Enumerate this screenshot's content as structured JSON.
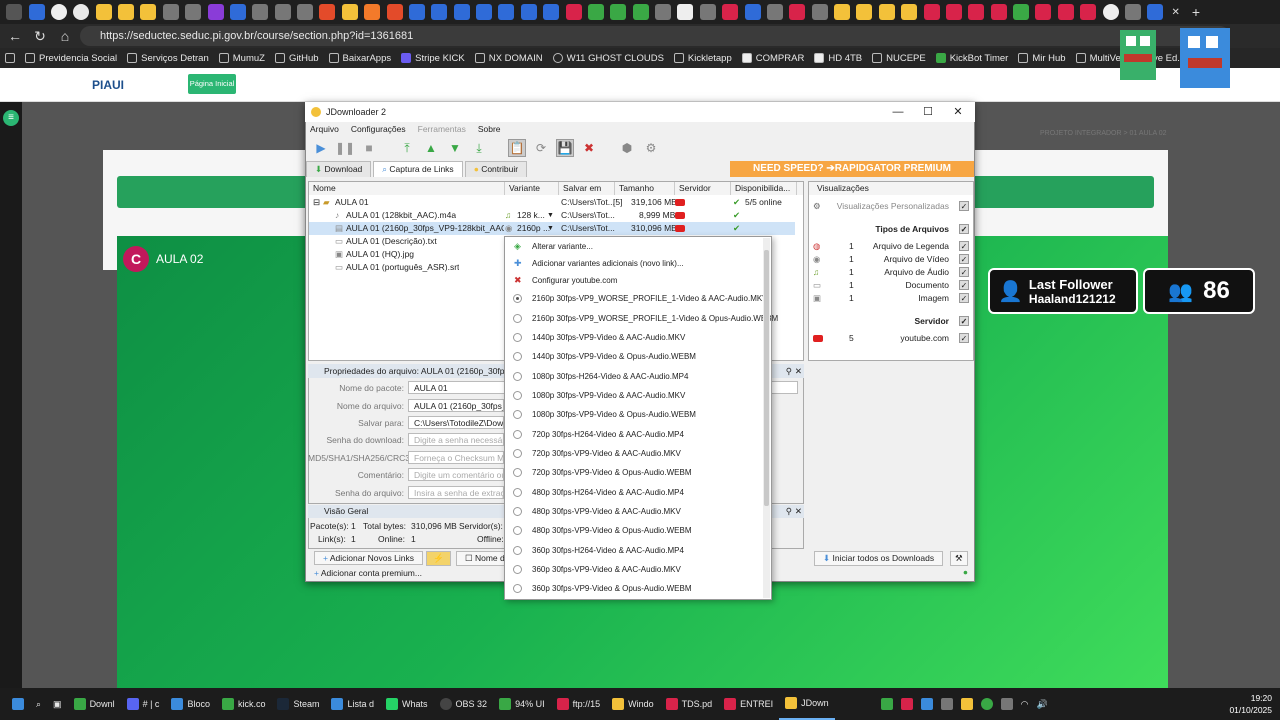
{
  "browser": {
    "url": "https://seductec.seduc.pi.gov.br/course/section.php?id=1361681",
    "bookmarks": [
      "Previdencia Social",
      "Serviços Detran",
      "MumuZ",
      "GitHub",
      "BaixarApps",
      "Stripe KICK",
      "NX DOMAIN",
      "W11 GHOST CLOUDS",
      "Kickletapp",
      "COMPRAR",
      "HD 4TB",
      "NUCEPE",
      "KickBot Timer",
      "Mir Hub",
      "MultiVersus Save Ed..."
    ]
  },
  "site": {
    "logo_text": "PIAUI",
    "home_button": "Página Inicial",
    "course_avatar": "C",
    "course_title": "AULA 02",
    "breadcrumb": "PROJETO INTEGRADOR  >  01 AULA 02"
  },
  "overlay": {
    "follower_title": "Last Follower",
    "follower_name": "Haaland121212",
    "viewer_count": "86"
  },
  "jd": {
    "title": "JDownloader 2",
    "menu": [
      "Arquivo",
      "Configurações",
      "Ferramentas",
      "Sobre"
    ],
    "tabs": [
      "Download",
      "Captura de Links",
      "Contribuir"
    ],
    "banner": "NEED SPEED? ➔RAPIDGATOR PREMIUM",
    "columns": [
      "Nome",
      "Variante",
      "Salvar em",
      "Tamanho",
      "Servidor",
      "Disponibilida..."
    ],
    "package": {
      "name": "AULA 01",
      "save": "C:\\Users\\Tot...",
      "count": "[5]",
      "size": "319,106 MB",
      "avail": "5/5 online"
    },
    "files": [
      {
        "name": "AULA 01 (128kbit_AAC).m4a",
        "variant": "128 k...",
        "save": "C:\\Users\\Tot...",
        "size": "8,999 MB"
      },
      {
        "name": "AULA 01 (2160p_30fps_VP9-128kbit_AAC).mkv",
        "variant": "2160p ...",
        "save": "C:\\Users\\Tot...",
        "size": "310,096 MB"
      },
      {
        "name": "AULA 01 (Descrição).txt",
        "variant": "",
        "save": "",
        "size": ""
      },
      {
        "name": "AULA 01 (HQ).jpg",
        "variant": "",
        "save": "",
        "size": ""
      },
      {
        "name": "AULA 01 (português_ASR).srt",
        "variant": "",
        "save": "",
        "size": ""
      }
    ],
    "viz": {
      "title": "Visualizações",
      "custom": "Visualizações Personalizadas",
      "types_title": "Tipos de Arquivos",
      "types": [
        {
          "count": "1",
          "label": "Arquivo de Legenda"
        },
        {
          "count": "1",
          "label": "Arquivo de Vídeo"
        },
        {
          "count": "1",
          "label": "Arquivo de Áudio"
        },
        {
          "count": "1",
          "label": "Documento"
        },
        {
          "count": "1",
          "label": "Imagem"
        }
      ],
      "server_title": "Servidor",
      "server": {
        "count": "5",
        "label": "youtube.com"
      }
    },
    "props": {
      "header": "Propriedades do arquivo: AULA 01 (2160p_30fps_VP",
      "fields": [
        {
          "label": "Nome do pacote:",
          "value": "AULA 01",
          "ph": false
        },
        {
          "label": "Nome do arquivo:",
          "value": "AULA 01 (2160p_30fps_VP",
          "ph": false
        },
        {
          "label": "Salvar para:",
          "value": "C:\\Users\\TotodileZ\\Downl",
          "ph": false
        },
        {
          "label": "Senha do download:",
          "value": "Digite a senha necessária",
          "ph": true
        },
        {
          "label": "MD5/SHA1/SHA256/CRC32:",
          "value": "Forneça o Checksum MD5",
          "ph": true
        },
        {
          "label": "Comentário:",
          "value": "Digite um comentário ou",
          "ph": true
        },
        {
          "label": "Senha do arquivo:",
          "value": "Insira a senha de extraçã",
          "ph": true
        }
      ]
    },
    "overview": {
      "header": "Visão Geral",
      "packages_label": "Pacote(s):",
      "packages": "1",
      "total_label": "Total bytes:",
      "total": "310,096 MB",
      "servers_label": "Servidor(s):",
      "links_label": "Link(s):",
      "links": "1",
      "online_label": "Online:",
      "online": "1",
      "offline_label": "Offline:"
    },
    "add_links": "Adicionar Novos Links",
    "name_label": "Nome d",
    "start_all": "Iniciar todos os Downloads",
    "add_premium": "Adicionar conta premium...",
    "context_actions": [
      "Alterar variante...",
      "Adicionar variantes adicionais (novo link)...",
      "Configurar youtube.com"
    ],
    "variants": [
      "2160p 30fps-VP9_WORSE_PROFILE_1-Video & AAC-Audio.MKV",
      "2160p 30fps-VP9_WORSE_PROFILE_1-Video & Opus-Audio.WEBM",
      "1440p 30fps-VP9-Video & AAC-Audio.MKV",
      "1440p 30fps-VP9-Video & Opus-Audio.WEBM",
      "1080p 30fps-H264-Video & AAC-Audio.MP4",
      "1080p 30fps-VP9-Video & AAC-Audio.MKV",
      "1080p 30fps-VP9-Video & Opus-Audio.WEBM",
      "720p 30fps-H264-Video & AAC-Audio.MP4",
      "720p 30fps-VP9-Video & AAC-Audio.MKV",
      "720p 30fps-VP9-Video & Opus-Audio.WEBM",
      "480p 30fps-H264-Video & AAC-Audio.MP4",
      "480p 30fps-VP9-Video & AAC-Audio.MKV",
      "480p 30fps-VP9-Video & Opus-Audio.WEBM",
      "360p 30fps-H264-Video & AAC-Audio.MP4",
      "360p 30fps-VP9-Video & AAC-Audio.MKV",
      "360p 30fps-VP9-Video & Opus-Audio.WEBM"
    ],
    "selected_variant": 0
  },
  "taskbar": {
    "apps": [
      "Downl",
      "# | c",
      "Bloco",
      "kick.co",
      "Steam",
      "Lista d",
      "Whats",
      "OBS 32",
      "94% UI",
      "ftp://15",
      "Windo",
      "TDS.pd",
      "ENTREI",
      "JDown"
    ],
    "time": "19:20",
    "date": "01/10/2025"
  },
  "colors": {
    "accent_green": "#26a15c",
    "yt_red": "#e02020",
    "banner": "#f7a643"
  }
}
